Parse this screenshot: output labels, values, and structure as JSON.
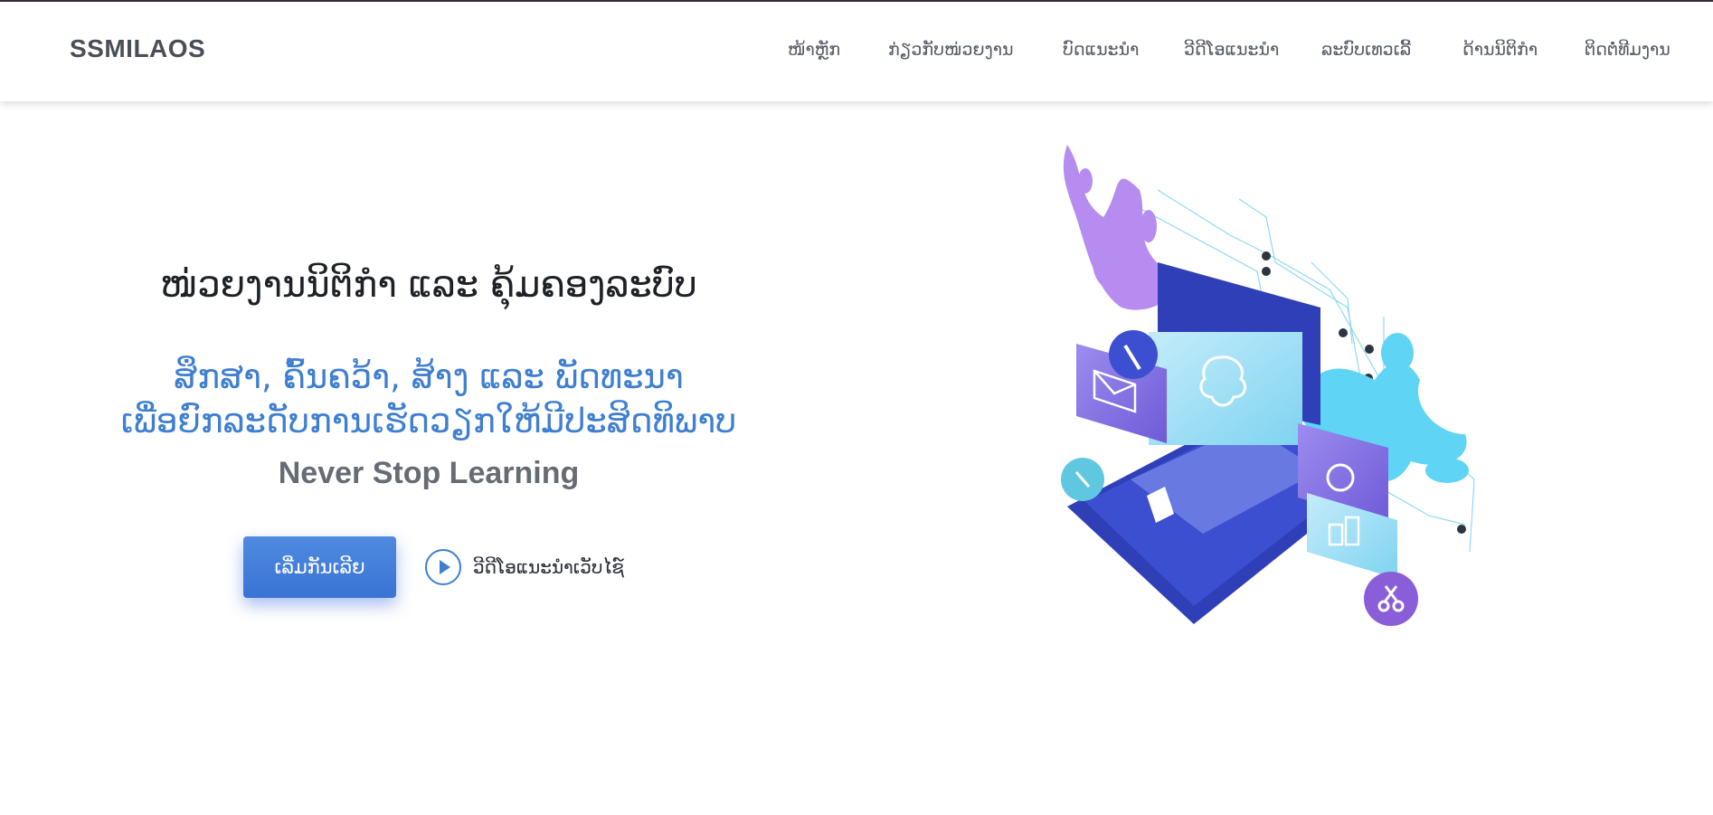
{
  "header": {
    "logo": "SSMILAOS",
    "nav": [
      {
        "label": "ໜ້າຫຼັກ"
      },
      {
        "label": "ກ່ຽວກັບໜ່ວຍງານ"
      },
      {
        "label": "ບົດແນະນຳ"
      },
      {
        "label": "ວີດີໂອແນະນຳ"
      },
      {
        "label": "ລະບົບເທວເລີ້"
      },
      {
        "label": "ດ້ານນິຕິກຳ"
      },
      {
        "label": "ຕິດຕໍ່ທີມງານ"
      }
    ]
  },
  "hero": {
    "title": "ໜ່ວຍງານນິຕິກຳ ແລະ ຄຸ້ມຄອງລະບົບ",
    "subtitle_line1": "ສຶກສາ, ຄົ້ນຄວ້າ, ສ້າງ ແລະ ພັດທະນາ",
    "subtitle_line2": "ເພື່ອຍົກລະດັບການເຮັດວຽກໃຫ້ມີປະສິດທິພາບ",
    "tagline": "Never Stop Learning",
    "primary_button": "ເລີ່ມກັນເລີຍ",
    "video_link": "ວີດີໂອແນະນຳເວັບໄຊ໌"
  },
  "colors": {
    "accent": "#3f7fd1",
    "laptop": "#2f3fb8",
    "splash_cyan": "#5fd4f5",
    "splash_purple": "#b78cf0"
  }
}
